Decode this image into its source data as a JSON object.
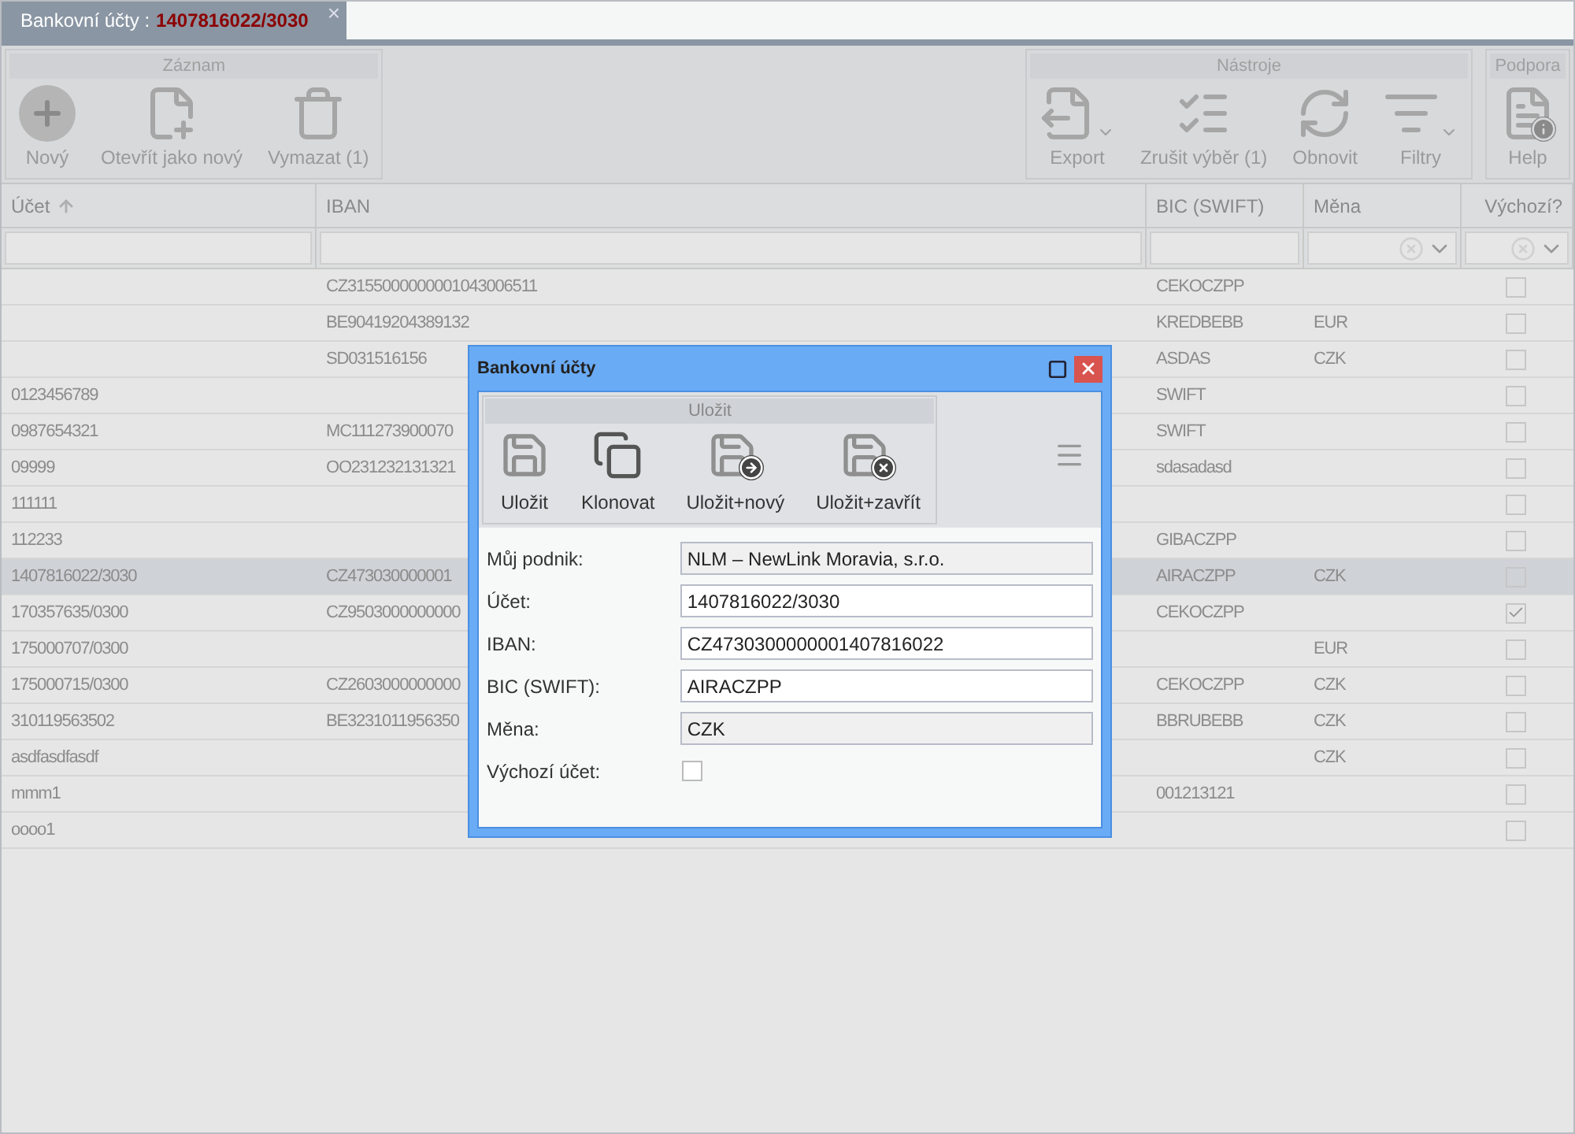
{
  "tab": {
    "title": "Bankovní účty :",
    "record": "1407816022/3030",
    "close": "×"
  },
  "ribbon": [
    {
      "title": "Záznam",
      "buttons": [
        {
          "label": "Nový",
          "kind": "new",
          "dropdown": false
        },
        {
          "label": "Otevřít jako nový",
          "kind": "open-new",
          "dropdown": false
        },
        {
          "label": "Vymazat (1)",
          "kind": "delete",
          "dropdown": false
        }
      ]
    },
    {
      "title": "Nástroje",
      "buttons": [
        {
          "label": "Export",
          "kind": "export",
          "dropdown": true
        },
        {
          "label": "Zrušit výběr (1)",
          "kind": "checklist",
          "dropdown": false
        },
        {
          "label": "Obnovit",
          "kind": "refresh",
          "dropdown": false
        },
        {
          "label": "Filtry",
          "kind": "filter",
          "dropdown": true
        }
      ]
    },
    {
      "title": "Podpora",
      "buttons": [
        {
          "label": "Help",
          "kind": "help",
          "dropdown": false
        }
      ]
    }
  ],
  "table": {
    "columns": [
      {
        "label": "Účet",
        "sorted": true,
        "kind": "text"
      },
      {
        "label": "IBAN",
        "sorted": false,
        "kind": "text"
      },
      {
        "label": "BIC (SWIFT)",
        "sorted": false,
        "kind": "text"
      },
      {
        "label": "Měna",
        "sorted": false,
        "kind": "select"
      },
      {
        "label": "Výchozí?",
        "sorted": false,
        "kind": "select"
      }
    ],
    "rows": [
      {
        "cells": [
          "",
          "CZ3155000000001043006511",
          "CEKOCZPP",
          ""
        ],
        "default": false,
        "selected": false
      },
      {
        "cells": [
          "",
          "BE90419204389132",
          "KREDBEBB",
          "EUR"
        ],
        "default": false,
        "selected": false
      },
      {
        "cells": [
          "",
          "SD031516156",
          "ASDAS",
          "CZK"
        ],
        "default": false,
        "selected": false
      },
      {
        "cells": [
          "0123456789",
          "",
          "SWIFT",
          ""
        ],
        "default": false,
        "selected": false
      },
      {
        "cells": [
          "0987654321",
          "MC111273900070",
          "SWIFT",
          ""
        ],
        "default": false,
        "selected": false
      },
      {
        "cells": [
          "09999",
          "OO231232131321",
          "sdasadasd",
          ""
        ],
        "default": false,
        "selected": false
      },
      {
        "cells": [
          "111111",
          "",
          "",
          ""
        ],
        "default": false,
        "selected": false
      },
      {
        "cells": [
          "112233",
          "",
          "GIBACZPP",
          ""
        ],
        "default": false,
        "selected": false
      },
      {
        "cells": [
          "1407816022/3030",
          "CZ473030000001",
          "AIRACZPP",
          "CZK"
        ],
        "default": false,
        "selected": true
      },
      {
        "cells": [
          "170357635/0300",
          "CZ9503000000000",
          "CEKOCZPP",
          ""
        ],
        "default": true,
        "selected": false
      },
      {
        "cells": [
          "175000707/0300",
          "",
          "",
          "EUR"
        ],
        "default": false,
        "selected": false
      },
      {
        "cells": [
          "175000715/0300",
          "CZ2603000000000",
          "CEKOCZPP",
          "CZK"
        ],
        "default": false,
        "selected": false
      },
      {
        "cells": [
          "310119563502",
          "BE3231011956350",
          "BBRUBEBB",
          "CZK"
        ],
        "default": false,
        "selected": false
      },
      {
        "cells": [
          "asdfasdfasdf",
          "",
          "",
          "CZK"
        ],
        "default": false,
        "selected": false
      },
      {
        "cells": [
          "mmm1",
          "",
          "001213121",
          ""
        ],
        "default": false,
        "selected": false
      },
      {
        "cells": [
          "oooo1",
          "",
          "",
          ""
        ],
        "default": false,
        "selected": false
      }
    ]
  },
  "dialog": {
    "title": "Bankovní účty",
    "group_title": "Uložit",
    "buttons": [
      {
        "label": "Uložit",
        "kind": "save"
      },
      {
        "label": "Klonovat",
        "kind": "clone"
      },
      {
        "label": "Uložit+nový",
        "kind": "save-new"
      },
      {
        "label": "Uložit+zavřít",
        "kind": "save-close"
      }
    ],
    "fields": [
      {
        "label": "Můj podnik:",
        "kind": "text",
        "value": "NLM – NewLink Moravia, s.r.o.",
        "readonly": true
      },
      {
        "label": "Účet:",
        "kind": "text",
        "value": "1407816022/3030",
        "readonly": false
      },
      {
        "label": "IBAN:",
        "kind": "text",
        "value": "CZ4730300000001407816022",
        "readonly": false
      },
      {
        "label": "BIC (SWIFT):",
        "kind": "text",
        "value": "AIRACZPP",
        "readonly": false
      },
      {
        "label": "Měna:",
        "kind": "text",
        "value": "CZK",
        "readonly": true
      },
      {
        "label": "Výchozí účet:",
        "kind": "checkbox",
        "checked": false
      }
    ]
  }
}
